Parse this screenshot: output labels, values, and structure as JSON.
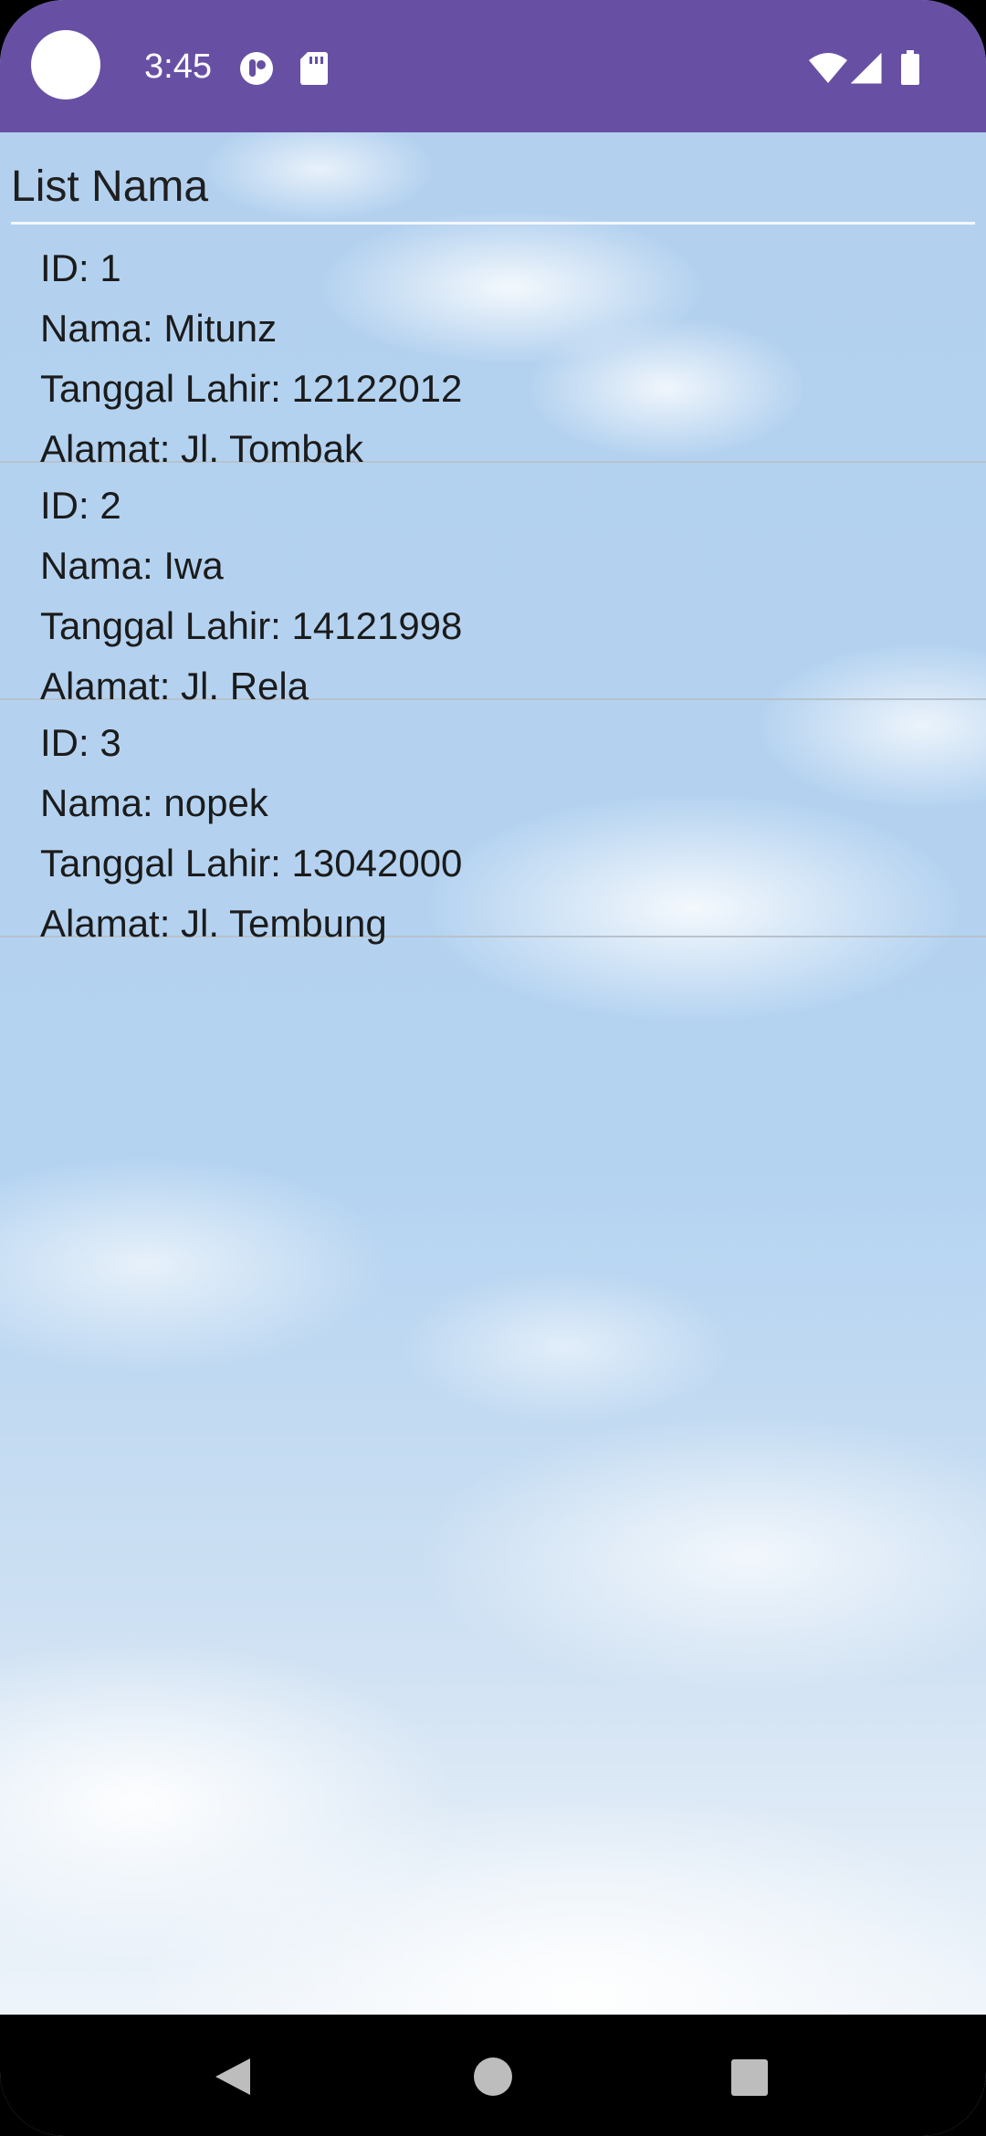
{
  "status_bar": {
    "time": "3:45",
    "background_color": "#6750a4",
    "left_icons": [
      "camera-cutout",
      "podcast-icon",
      "sd-card-icon"
    ],
    "right_icons": [
      "wifi-icon",
      "signal-icon",
      "battery-icon"
    ]
  },
  "page": {
    "title": "List Nama"
  },
  "records": [
    {
      "id": "ID: 1",
      "nama": "Nama: Mitunz",
      "tanggal_lahir": "Tanggal Lahir: 12122012",
      "alamat": "Alamat: Jl. Tombak"
    },
    {
      "id": "ID: 2",
      "nama": "Nama: Iwa",
      "tanggal_lahir": "Tanggal Lahir: 14121998",
      "alamat": "Alamat: Jl. Rela"
    },
    {
      "id": "ID: 3",
      "nama": "Nama: nopek",
      "tanggal_lahir": "Tanggal Lahir: 13042000",
      "alamat": "Alamat: Jl. Tembung"
    }
  ],
  "nav_bar": {
    "buttons": [
      "back-icon",
      "home-icon",
      "recents-icon"
    ]
  }
}
